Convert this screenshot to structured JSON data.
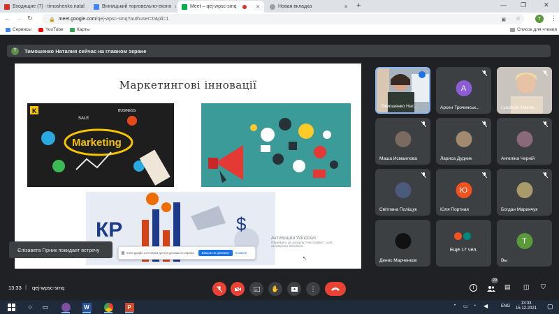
{
  "browser": {
    "tabs": [
      {
        "label": "Входящие (7) - timoshenko.natal",
        "favicon_color": "#d93025"
      },
      {
        "label": "Вінницький торговельно-еконо",
        "favicon_color": "#4285f4"
      },
      {
        "label": "Meet – qej-wpsc-smq",
        "favicon_color": "#00ac47",
        "active": true
      },
      {
        "label": "Новая вкладка",
        "favicon_color": "#9aa0a6"
      }
    ],
    "new_tab_symbol": "+",
    "url_host": "meet.google.com",
    "url_path": "/qej-wpsc-smq?authuser=0&pli=1",
    "bookmarks": [
      {
        "label": "Сервисы",
        "icon_color": "#4285f4"
      },
      {
        "label": "YouTube",
        "icon_color": "#ff0000"
      },
      {
        "label": "Карты",
        "icon_color": "#34a853"
      }
    ],
    "other_bookmarks": "Список для чтения",
    "profile_initial": "T"
  },
  "meet": {
    "banner": {
      "initial": "T",
      "text": "Тимошенко Наталия сейчас на главном экране"
    },
    "slide": {
      "title": "Маркетингові інновації",
      "marketing_word": "Marketing",
      "kp_text": "КР",
      "popup_text": "meet.google.com зараз доступ до вашого екрана.",
      "popup_primary": "Більше не ділитися",
      "popup_secondary": "Сховати",
      "activation_title": "Активация Windows",
      "activation_body": "Перейдіть до розділу \"Настройки\", щоб активувати Windows."
    },
    "toast": "Єлізавета Гірник покидает встречу",
    "participants": [
      {
        "name": "Тимошенко Нат...",
        "type": "video",
        "speaking": true
      },
      {
        "name": "Арсен Трочинськ...",
        "initial": "А",
        "color": "#8b5cd6"
      },
      {
        "name": "Lyudmila Malcile...",
        "type": "video2"
      },
      {
        "name": "Маша Исмаилова",
        "type": "photo",
        "color": "#7a6a60"
      },
      {
        "name": "Лариса Дудник",
        "type": "photo",
        "color": "#a08a70"
      },
      {
        "name": "Ангеліна Черній",
        "type": "photo",
        "color": "#8a6a7a"
      },
      {
        "name": "Світлана Поліщук",
        "type": "photo",
        "color": "#4a5a7a"
      },
      {
        "name": "Юля Портная",
        "initial": "Ю",
        "color": "#f4511e"
      },
      {
        "name": "Богдан Маринчук",
        "type": "photo",
        "color": "#a89a6a"
      },
      {
        "name": "Денис Марченков",
        "type": "photo",
        "color": "#111111"
      },
      {
        "name": "Ещё 17 чел.",
        "type": "more"
      },
      {
        "name": "Вы",
        "initial": "T",
        "color": "#5a9a3a"
      }
    ],
    "bottom": {
      "time": "13:33",
      "separator": "|",
      "meeting_code": "qej-wpsc-smq",
      "participants_count": "29"
    }
  },
  "taskbar": {
    "lang": "ENG",
    "time": "13:33",
    "date": "15.12.2021"
  }
}
